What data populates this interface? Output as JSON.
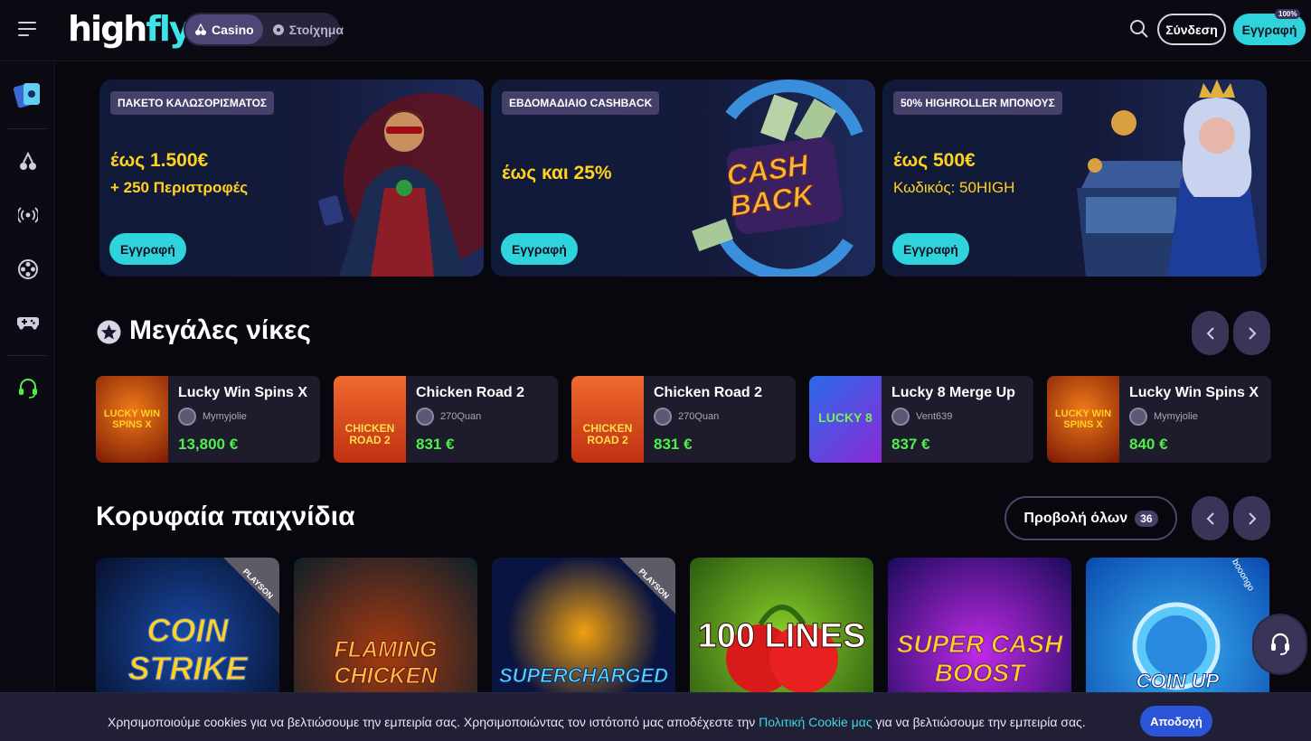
{
  "header": {
    "logo_a": "high",
    "logo_b": "fly",
    "casino_label": "Casino",
    "sports_label": "Στοίχημα",
    "login_label": "Σύνδεση",
    "register_label": "Εγγραφή",
    "register_badge": "100%"
  },
  "promos": [
    {
      "tag": "ΠΑΚΕΤΟ ΚΑΛΩΣΟΡΙΣΜΑΤΟΣ",
      "line1": "έως 1.500€",
      "line2": "+ 250 Περιστροφές",
      "button": "Εγγραφή"
    },
    {
      "tag": "ΕΒΔΟΜΑΔΙΑΙΟ CASHBACK",
      "line1": "έως και 25%",
      "line2": "",
      "button": "Εγγραφή",
      "art_text1": "CASH",
      "art_text2": "BACK"
    },
    {
      "tag": "50% HIGHROLLER ΜΠΟΝΟΥΣ",
      "line1": "έως 500€",
      "line2": "Κωδικός: 50HIGH",
      "button": "Εγγραφή"
    }
  ],
  "big_wins": {
    "title": "Μεγάλες νίκες",
    "items": [
      {
        "game": "Lucky Win Spins X",
        "user": "Mymyjolie",
        "amount": "13,800 €",
        "thumb": "LUCKY WIN SPINS X"
      },
      {
        "game": "Chicken Road 2",
        "user": "270Quan",
        "amount": "831 €",
        "thumb": "CHICKEN ROAD 2"
      },
      {
        "game": "Chicken Road 2",
        "user": "270Quan",
        "amount": "831 €",
        "thumb": "CHICKEN ROAD 2"
      },
      {
        "game": "Lucky 8 Merge Up",
        "user": "Vent639",
        "amount": "837 €",
        "thumb": "LUCKY 8"
      },
      {
        "game": "Lucky Win Spins X",
        "user": "Mymyjolie",
        "amount": "840 €",
        "thumb": "LUCKY WIN SPINS X"
      }
    ]
  },
  "top_games": {
    "title": "Κορυφαία παιχνίδια",
    "view_all": "Προβολή όλων",
    "count": "36",
    "tiles": [
      {
        "name": "COIN STRIKE",
        "provider": "PLAYSON"
      },
      {
        "name": "FLAMING CHICKEN",
        "provider": ""
      },
      {
        "name": "SUPERCHARGED",
        "provider": "PLAYSON"
      },
      {
        "name": "100 LINES",
        "provider": ""
      },
      {
        "name": "SUPER CASH BOOST",
        "provider": ""
      },
      {
        "name": "COIN UP",
        "provider": "booongo"
      }
    ]
  },
  "cookie": {
    "text_before": "Χρησιμοποιούμε cookies για να βελτιώσουμε την εμπειρία σας. Χρησιμοποιώντας τον ιστότοπό μας αποδέχεστε την ",
    "link": "Πολιτική Cookie μας",
    "text_after": " για να βελτιώσουμε την εμπειρία σας.",
    "accept": "Αποδοχή"
  },
  "colors": {
    "accent": "#2fd3dc",
    "win": "#4df04a",
    "gold": "#ffd21f",
    "panel": "#1e1c2c",
    "button_dark": "#3a3459"
  },
  "sidebar_icons": [
    "cards-icon",
    "cherries-icon",
    "live-broadcast-icon",
    "film-reel-icon",
    "gamepad-icon",
    "headset-icon"
  ]
}
